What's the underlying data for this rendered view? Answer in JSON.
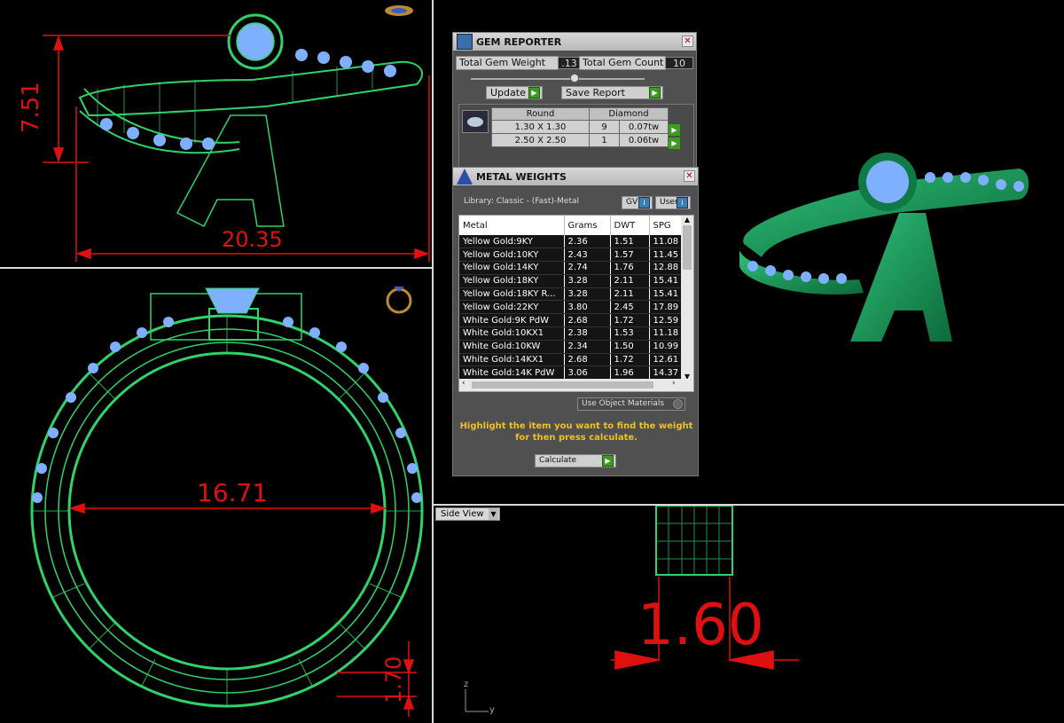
{
  "viewports": {
    "top_left": {
      "dim_height": "7.51",
      "dim_width": "20.35"
    },
    "bottom_left": {
      "dim_diameter": "16.71",
      "dim_thickness": "1.70"
    },
    "bottom_right": {
      "view_label": "Side View",
      "dim_width": "1.60",
      "axis_z": "z",
      "axis_y": "y"
    }
  },
  "gem_reporter": {
    "title": "GEM REPORTER",
    "total_weight_label": "Total Gem Weight",
    "total_weight_value": ".13",
    "total_count_label": "Total Gem Count",
    "total_count_value": "10",
    "update_label": "Update",
    "save_label": "Save Report",
    "headers": [
      "Round",
      "Diamond"
    ],
    "rows": [
      {
        "size": "1.30 X 1.30",
        "count": "9",
        "weight": "0.07tw"
      },
      {
        "size": "2.50 X 2.50",
        "count": "1",
        "weight": "0.06tw"
      }
    ]
  },
  "metal_weights": {
    "title": "METAL WEIGHTS",
    "library": "Library: Classic - (Fast)-Metal",
    "gv_label": "GV",
    "user_label": "User",
    "columns": [
      "Metal",
      "Grams",
      "DWT",
      "SPG"
    ],
    "rows": [
      [
        "Yellow Gold:9KY",
        "2.36",
        "1.51",
        "11.08"
      ],
      [
        "Yellow Gold:10KY",
        "2.43",
        "1.57",
        "11.45"
      ],
      [
        "Yellow Gold:14KY",
        "2.74",
        "1.76",
        "12.88"
      ],
      [
        "Yellow Gold:18KY",
        "3.28",
        "2.11",
        "15.41"
      ],
      [
        "Yellow Gold:18KY R...",
        "3.28",
        "2.11",
        "15.41"
      ],
      [
        "Yellow Gold:22KY",
        "3.80",
        "2.45",
        "17.89"
      ],
      [
        "White Gold:9K PdW",
        "2.68",
        "1.72",
        "12.59"
      ],
      [
        "White Gold:10KX1",
        "2.38",
        "1.53",
        "11.18"
      ],
      [
        "White Gold:10KW",
        "2.34",
        "1.50",
        "10.99"
      ],
      [
        "White Gold:14KX1",
        "2.68",
        "1.72",
        "12.61"
      ],
      [
        "White Gold:14K PdW",
        "3.06",
        "1.96",
        "14.37"
      ]
    ],
    "use_object_label": "Use Object Materials",
    "hint_line1": "Highlight the item you want to find the weight",
    "hint_line2": "for then press calculate.",
    "calculate_label": "Calculate"
  },
  "colors": {
    "wire": "#2fd36a",
    "gem": "#7fb0ff",
    "dim": "#e01010",
    "render": "#1a9a5a"
  }
}
